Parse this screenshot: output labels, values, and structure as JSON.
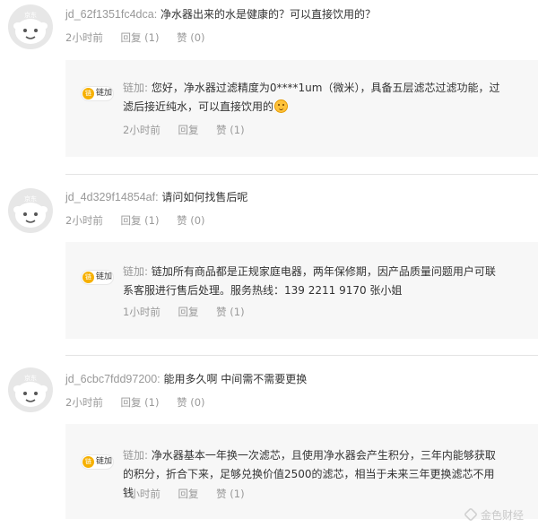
{
  "comments": [
    {
      "username": "jd_62f1351fc4dca:",
      "text": "净水器出来的水是健康的？可以直接饮用的？",
      "time": "2小时前",
      "reply_label": "回复 (1)",
      "like_label": "赞 (0)",
      "seller_reply": {
        "badge_icon": "链",
        "badge_name": "链加",
        "shop": "链加:",
        "text": "您好，净水器过滤精度为0****1um（微米），具备五层滤芯过滤功能，过滤后接近纯水，可以直接饮用的",
        "has_emoji": true,
        "time": "2小时前",
        "reply_label": "回复",
        "like_label": "赞 (1)"
      }
    },
    {
      "username": "jd_4d329f14854af:",
      "text": "请问如何找售后呢",
      "time": "2小时前",
      "reply_label": "回复 (1)",
      "like_label": "赞 (0)",
      "seller_reply": {
        "badge_icon": "链",
        "badge_name": "链加",
        "shop": "链加:",
        "text": "链加所有商品都是正规家庭电器，两年保修期，因产品质量问题用户可联系客服进行售后处理。服务热线：139 2211 9170 张小姐",
        "has_emoji": false,
        "time": "1小时前",
        "reply_label": "回复",
        "like_label": "赞 (1)"
      }
    },
    {
      "username": "jd_6cbc7fdd97200:",
      "text": "能用多久啊 中间需不需要更换",
      "time": "2小时前",
      "reply_label": "回复 (1)",
      "like_label": "赞 (0)",
      "seller_reply": {
        "badge_icon": "链",
        "badge_name": "链加",
        "shop": "链加:",
        "text": "净水器基本一年换一次滤芯，且使用净水器会产生积分，三年内能够获取的积分，折合下来，足够兑换价值2500的滤芯，相当于未来三年更换滤芯不用钱",
        "has_emoji": false,
        "time": "1小时前",
        "reply_label": "回复",
        "like_label": "赞 (1)"
      }
    }
  ],
  "watermark": "金色财经"
}
